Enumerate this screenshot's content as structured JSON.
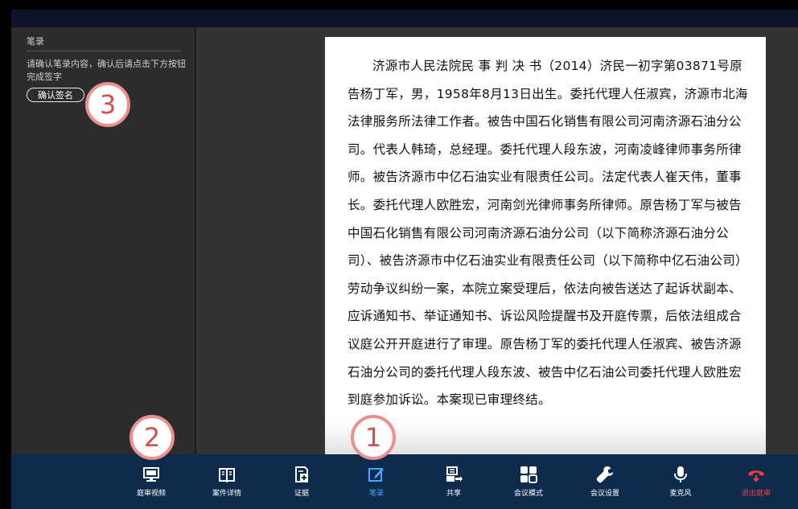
{
  "notes_panel": {
    "title": "笔录",
    "instruction": "请确认笔录内容，确认后请点击下方按钮完成签字",
    "confirm_button": "确认签名"
  },
  "document": {
    "text": "济源市人民法院民 事 判 决 书（2014）济民一初字第03871号原告杨丁军，男，1958年8月13日出生。委托代理人任淑宾，济源市北海法律服务所法律工作者。被告中国石化销售有限公司河南济源石油分公司。代表人韩琦，总经理。委托代理人段东波，河南凌峰律师事务所律师。被告济源市中亿石油实业有限责任公司。法定代表人崔天伟，董事长。委托代理人欧胜宏，河南剑光律师事务所律师。原告杨丁军与被告中国石化销售有限公司河南济源石油分公司（以下简称济源石油分公司）、被告济源市中亿石油实业有限责任公司（以下简称中亿石油公司）劳动争议纠纷一案，本院立案受理后，依法向被告送达了起诉状副本、应诉通知书、举证通知书、诉讼风险提醒书及开庭传票，后依法组成合议庭公开开庭进行了审理。原告杨丁军的委托代理人任淑宾、被告济源石油分公司的委托代理人段东波、被告中亿石油公司委托代理人欧胜宏到庭参加诉讼。本案现已审理终结。"
  },
  "toolbar": {
    "items": [
      {
        "label": "庭审视频",
        "icon": "monitor-icon"
      },
      {
        "label": "案件详情",
        "icon": "book-icon"
      },
      {
        "label": "证据",
        "icon": "evidence-add-icon"
      },
      {
        "label": "笔录",
        "icon": "edit-note-icon",
        "active": true
      },
      {
        "label": "共享",
        "icon": "share-icon"
      },
      {
        "label": "会议模式",
        "icon": "grid-mode-icon"
      },
      {
        "label": "会议设置",
        "icon": "wrench-icon"
      },
      {
        "label": "麦克风",
        "icon": "microphone-icon"
      },
      {
        "label": "退出庭审",
        "icon": "hangup-icon",
        "danger": true
      }
    ]
  },
  "annotations": [
    {
      "number": "1"
    },
    {
      "number": "2"
    },
    {
      "number": "3"
    }
  ],
  "colors": {
    "accent": "#4aa3ff",
    "danger": "#ff3b3b",
    "toolbar_bg": "#0d2b4d",
    "badge_border": "#ee8f8f",
    "badge_text": "#d84b4b"
  }
}
